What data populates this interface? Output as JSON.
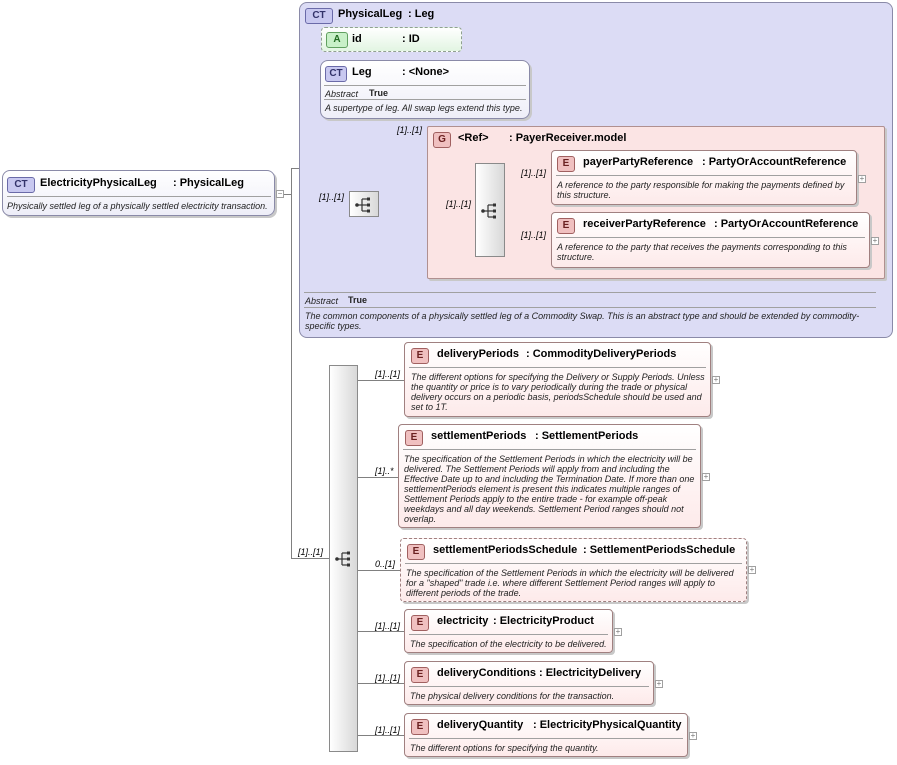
{
  "root": {
    "badge": "CT",
    "name": "ElectricityPhysicalLeg",
    "type": ": PhysicalLeg",
    "description": "Physically settled leg of a physically settled electricity transaction."
  },
  "physicalLeg": {
    "badge": "CT",
    "name": "PhysicalLeg",
    "type": ": Leg",
    "abstract_label": "Abstract",
    "abstract_value": "True",
    "description": "The common components of a physically settled leg of a Commodity Swap. This is an abstract type and should be extended by commodity-specific types."
  },
  "idAttr": {
    "badge": "A",
    "name": "id",
    "type": ": ID"
  },
  "leg": {
    "badge": "CT",
    "name": "Leg",
    "type": ": <None>",
    "abstract_label": "Abstract",
    "abstract_value": "True",
    "description": "A supertype of leg. All swap legs extend this type."
  },
  "group": {
    "badge": "G",
    "name": "<Ref>",
    "type": ": PayerReceiver.model",
    "multiplicity": "[1]..[1]",
    "seq_multiplicity": "[1]..[1]",
    "elements": [
      {
        "badge": "E",
        "name": "payerPartyReference",
        "type": ": PartyOrAccountReference",
        "multiplicity": "[1]..[1]",
        "description": "A reference to the party responsible for making the payments defined by this structure."
      },
      {
        "badge": "E",
        "name": "receiverPartyReference",
        "type": ": PartyOrAccountReference",
        "multiplicity": "[1]..[1]",
        "description": "A reference to the party that receives the payments corresponding to this structure."
      }
    ]
  },
  "topSeqMultiplicity": "[1]..[1]",
  "mainSeqMultiplicity": "[1]..[1]",
  "elements": [
    {
      "badge": "E",
      "name": "deliveryPeriods",
      "type": ": CommodityDeliveryPeriods",
      "multiplicity": "[1]..[1]",
      "description": "The different options for specifying the Delivery or Supply Periods. Unless the quantity or price is to vary periodically during the trade or physical delivery occurs on a periodic basis, periodsSchedule should be used and set to 1T."
    },
    {
      "badge": "E",
      "name": "settlementPeriods",
      "type": ": SettlementPeriods",
      "multiplicity": "[1]..*",
      "description": "The specification of the Settlement Periods in which the electricity will be delivered. The Settlement Periods will apply from and including the Effective Date up to and including the Termination Date. If more than one settlementPeriods element is present this indicates multiple ranges of Settlement Periods apply to the entire trade - for example off-peak weekdays and all day weekends. Settlement Period ranges should not overlap."
    },
    {
      "badge": "E",
      "name": "settlementPeriodsSchedule",
      "type": ": SettlementPeriodsSchedule",
      "multiplicity": "0..[1]",
      "description": "The specification of the Settlement Periods in which the electricity will be delivered for a \"shaped\" trade i.e. where different Settlement Period ranges will apply to different periods of the trade."
    },
    {
      "badge": "E",
      "name": "electricity",
      "type": ": ElectricityProduct",
      "multiplicity": "[1]..[1]",
      "description": "The specification of the electricity to be delivered."
    },
    {
      "badge": "E",
      "name": "deliveryConditions",
      "type": ": ElectricityDelivery",
      "multiplicity": "[1]..[1]",
      "description": "The physical delivery conditions for the transaction."
    },
    {
      "badge": "E",
      "name": "deliveryQuantity",
      "type": ": ElectricityPhysicalQuantity",
      "multiplicity": "[1]..[1]",
      "description": "The different options for specifying the quantity."
    }
  ],
  "expander": "+",
  "collapser": "−"
}
